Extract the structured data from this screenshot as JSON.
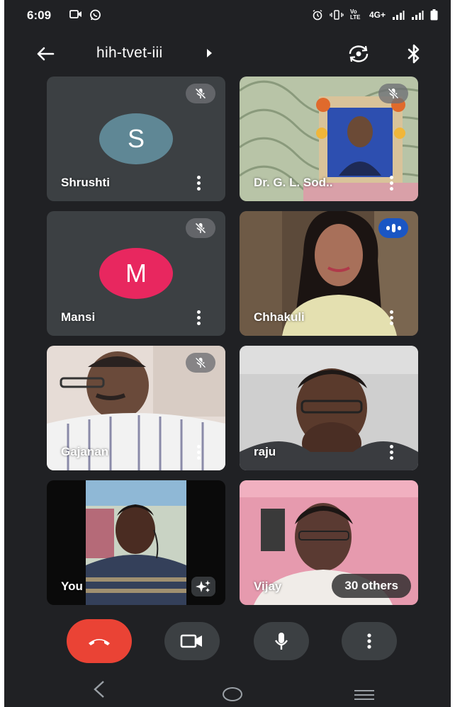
{
  "status": {
    "time": "6:09",
    "network": "4G+",
    "volte": "Vo LTE",
    "icons": [
      "camera-icon",
      "whatsapp-icon",
      "alarm-icon",
      "vibrate-icon",
      "signal-icon",
      "signal-icon",
      "battery-icon"
    ]
  },
  "meeting": {
    "title": "hih-tvet-iii",
    "icons": [
      "back-arrow-icon",
      "caret-right-icon",
      "switch-camera-icon",
      "bluetooth-icon"
    ]
  },
  "tiles": [
    {
      "name": "Shrushti",
      "initial": "S",
      "avatar_color": "#5f8795",
      "state": "muted"
    },
    {
      "name": "Dr. G. L. Sod..",
      "state": "muted",
      "video": true
    },
    {
      "name": "Mansi",
      "initial": "M",
      "avatar_color": "#e8275f",
      "state": "muted"
    },
    {
      "name": "Chhakuli",
      "state": "speaking",
      "video": true
    },
    {
      "name": "Gajanan",
      "state": "muted",
      "video": true
    },
    {
      "name": "raju",
      "state": "unmuted",
      "video": true
    },
    {
      "name": "You",
      "state": "self",
      "video": true,
      "icons": [
        "sparkle-effects-icon"
      ]
    },
    {
      "name": "Vijay",
      "state": "unmuted",
      "video": true,
      "others_label": "30 others"
    }
  ],
  "controls": {
    "icons": [
      "end-call-icon",
      "camera-icon",
      "microphone-icon",
      "more-options-icon"
    ],
    "end_color": "#ea4335"
  },
  "navigation": {
    "icons": [
      "nav-back-icon",
      "nav-home-icon",
      "nav-recents-icon"
    ]
  },
  "colors": {
    "background": "#202124",
    "tile": "#3c4043",
    "speaking": "#1a56c4"
  }
}
